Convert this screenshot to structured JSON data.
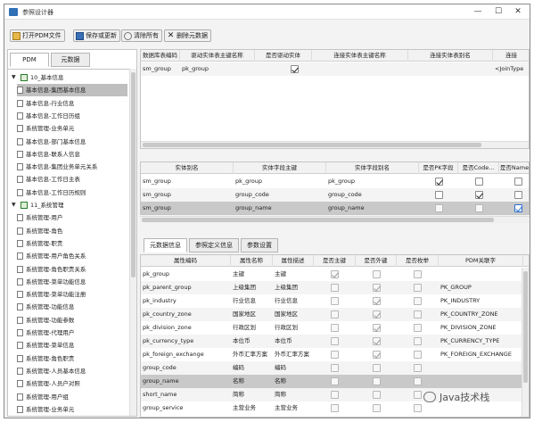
{
  "window": {
    "title": "参照设计器",
    "controls": [
      "—",
      "☐",
      "✕"
    ]
  },
  "toolbar": {
    "open_label": "打开PDM文件",
    "save_label": "保存或更新",
    "clear_label": "清除所有",
    "delete_label": "删除元数据"
  },
  "left": {
    "tabs": [
      "PDM",
      "元数据"
    ],
    "tree": [
      {
        "label": "10_基本信息",
        "level": 0,
        "folder": true,
        "expanded": true
      },
      {
        "label": "基本信息-集团基本信息",
        "level": 1,
        "selected": true
      },
      {
        "label": "基本信息-行业信息",
        "level": 1
      },
      {
        "label": "基本信息-工作日历组",
        "level": 1
      },
      {
        "label": "系统管理-业务单元",
        "level": 1
      },
      {
        "label": "基本信息-部门基本信息",
        "level": 1
      },
      {
        "label": "基本信息-联系人信息",
        "level": 1
      },
      {
        "label": "基本信息-集团业务单元关系",
        "level": 1
      },
      {
        "label": "基本信息-工作日主表",
        "level": 1
      },
      {
        "label": "基本信息-工作日历规则",
        "level": 1
      },
      {
        "label": "11_系统管理",
        "level": 0,
        "folder": true,
        "expanded": true
      },
      {
        "label": "系统管理-用户",
        "level": 1
      },
      {
        "label": "系统管理-角色",
        "level": 1
      },
      {
        "label": "系统管理-职责",
        "level": 1
      },
      {
        "label": "系统管理-用户角色关系",
        "level": 1
      },
      {
        "label": "系统管理-角色职责关系",
        "level": 1
      },
      {
        "label": "系统管理-菜单功能信息",
        "level": 1
      },
      {
        "label": "系统管理-菜单功能注册",
        "level": 1
      },
      {
        "label": "系统管理-功能信息",
        "level": 1
      },
      {
        "label": "系统管理-功能参数",
        "level": 1
      },
      {
        "label": "系统管理-代理用户",
        "level": 1
      },
      {
        "label": "系统管理-菜单信息",
        "level": 1
      },
      {
        "label": "系统管理-角色职责",
        "level": 1
      },
      {
        "label": "系统管理-人员基本信息",
        "level": 1
      },
      {
        "label": "系统管理-人员户对照",
        "level": 1
      },
      {
        "label": "系统管理-用户组",
        "level": 1
      },
      {
        "label": "系统管理-业务单元",
        "level": 1
      }
    ]
  },
  "table1": {
    "headers": [
      "数据库表编码",
      "驱动实体表主键名称",
      "是否驱动实体",
      "连接实体表主键名称",
      "连接实体表别名",
      "连接"
    ],
    "rows": [
      {
        "code": "sm_group",
        "pk": "pk_group",
        "drive": true,
        "join_pk": "",
        "alias": "",
        "join": "<JoinType"
      }
    ]
  },
  "table2": {
    "headers": [
      "实体别名",
      "实体字段主键",
      "实体字段别名",
      "是否PK字段",
      "是否Code...",
      "是否Name"
    ],
    "rows": [
      {
        "alias": "sm_group",
        "field": "pk_group",
        "falias": "pk_group",
        "pk": true,
        "code": false,
        "name": false
      },
      {
        "alias": "sm_group",
        "field": "group_code",
        "falias": "group_code",
        "pk": false,
        "code": true,
        "name": false
      },
      {
        "alias": "sm_group",
        "field": "group_name",
        "falias": "group_name",
        "pk": false,
        "code": false,
        "name": true
      }
    ]
  },
  "subtabs": [
    "元数据信息",
    "参照定义信息",
    "参数设置"
  ],
  "table3": {
    "headers": [
      "属性编码",
      "属性名称",
      "属性描述",
      "是否主键",
      "是否外键",
      "是否枚举",
      "PDM关联字"
    ],
    "rows": [
      {
        "code": "pk_group",
        "name": "主键",
        "desc": "主键",
        "pkey": true,
        "fkey": false,
        "enum": false,
        "ref": ""
      },
      {
        "code": "pk_parent_group",
        "name": "上级集团",
        "desc": "上级集团",
        "pkey": false,
        "fkey": true,
        "enum": false,
        "ref": "PK_GROUP"
      },
      {
        "code": "pk_industry",
        "name": "行业信息",
        "desc": "行业信息",
        "pkey": false,
        "fkey": true,
        "enum": false,
        "ref": "PK_INDUSTRY"
      },
      {
        "code": "pk_country_zone",
        "name": "国家地区",
        "desc": "国家地区",
        "pkey": false,
        "fkey": true,
        "enum": false,
        "ref": "PK_COUNTRY_ZONE"
      },
      {
        "code": "pk_division_zone",
        "name": "行政区划",
        "desc": "行政区划",
        "pkey": false,
        "fkey": true,
        "enum": false,
        "ref": "PK_DIVISION_ZONE"
      },
      {
        "code": "pk_currency_type",
        "name": "本位币",
        "desc": "本位币",
        "pkey": false,
        "fkey": true,
        "enum": false,
        "ref": "PK_CURRENCY_TYPE"
      },
      {
        "code": "pk_foreign_exchange",
        "name": "外币汇率方案",
        "desc": "外币汇率方案",
        "pkey": false,
        "fkey": true,
        "enum": false,
        "ref": "PK_FOREIGN_EXCHANGE"
      },
      {
        "code": "group_code",
        "name": "编码",
        "desc": "编码",
        "pkey": false,
        "fkey": false,
        "enum": false,
        "ref": ""
      },
      {
        "code": "group_name",
        "name": "名称",
        "desc": "名称",
        "pkey": false,
        "fkey": false,
        "enum": false,
        "ref": ""
      },
      {
        "code": "short_name",
        "name": "简称",
        "desc": "简称",
        "pkey": false,
        "fkey": false,
        "enum": false,
        "ref": ""
      },
      {
        "code": "group_service",
        "name": "主营业务",
        "desc": "主营业务",
        "pkey": false,
        "fkey": false,
        "enum": false,
        "ref": ""
      }
    ]
  },
  "watermark": "Java技术栈"
}
